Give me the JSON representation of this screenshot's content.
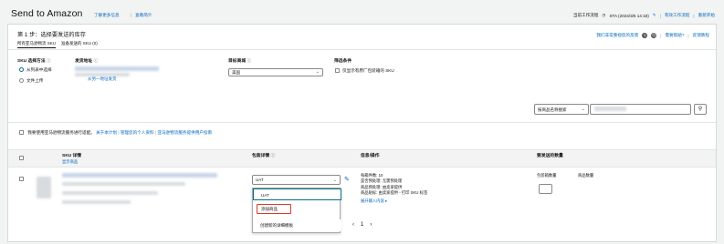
{
  "header": {
    "title": "Send to Amazon",
    "learn_more": "了解更多信息",
    "sep": "|",
    "video": "查看简介",
    "workflow": "当前工作流程",
    "sta": "STA (2024/3/5 14:18)",
    "restart": "有效工作流程",
    "restart2": "重新开始"
  },
  "step": {
    "title": "第 1 步：选择要发送的库存",
    "feedback": "我们非常重视您的反馈",
    "help": "需要帮助?",
    "more": "反馈教程",
    "tabs": [
      "所有亚马逊物流 SKU",
      "准备发送的 SKU (0)"
    ]
  },
  "form": {
    "sku_method_label": "SKU 选择方法",
    "option_list": "从列表中选择",
    "option_upload": "文件上传",
    "ship_from_label": "发货地址",
    "ship_from_link": "从另一地址发货",
    "marketplace_label": "目标商城",
    "marketplace_value": "美国",
    "filter_label": "筛选条件",
    "filter_option": "仅显示有原厂包装箱的 SKU",
    "search_by_value": "按商品名称搜索",
    "search_icon": "search-icon"
  },
  "notice": {
    "text": "我要使用亚马逊物流服务进行适配。",
    "link1": "关于本计划",
    "link2": "管理您的个人资料",
    "link3": "亚马逊物流服务提供用户指南"
  },
  "table": {
    "col_sku": "SKU 详情",
    "col_sku_sub": "显示商品",
    "col_packing": "包装详情",
    "col_info": "信息/操作",
    "col_qty": "要发送的数量"
  },
  "row": {
    "packing_select_value": "UAT",
    "info_lines": [
      "每箱件数: 10",
      "是否预处理: 无需预处理",
      "商品预处理: 由卖家提供",
      "商品贴标: 由卖家提供 - 打印 SKU 标签"
    ],
    "expand": "展开输入内容",
    "qty_boxes_label": "包装箱数量",
    "qty_units_label": "商品数量"
  },
  "dropdown": {
    "options": [
      "UAT",
      "添加商品",
      "创建新的详细模板"
    ]
  },
  "pagination": {
    "prev": "‹",
    "page": "1",
    "next": "›"
  },
  "colors": {
    "link": "#0066c0",
    "highlight": "#d93a2b",
    "focus": "#007185"
  }
}
